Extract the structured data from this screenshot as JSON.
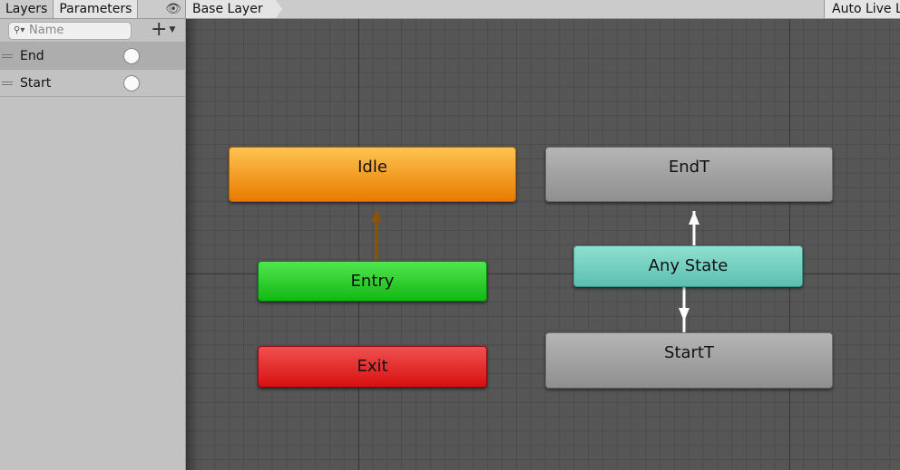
{
  "left_panel": {
    "tabs": [
      {
        "label": "Layers",
        "active": false
      },
      {
        "label": "Parameters",
        "active": true
      }
    ],
    "search_placeholder": "Name",
    "parameters": [
      {
        "name": "End",
        "type": "trigger",
        "selected": true
      },
      {
        "name": "Start",
        "type": "trigger",
        "selected": false
      }
    ]
  },
  "top_bar": {
    "breadcrumb": "Base Layer",
    "auto_live_link": "Auto Live Link"
  },
  "graph": {
    "states": {
      "idle": "Idle",
      "endt": "EndT",
      "entry": "Entry",
      "any_state": "Any State",
      "exit": "Exit",
      "startt": "StartT"
    },
    "colors": {
      "default_state": "#e87b00",
      "entry": "#14b814",
      "any_state": "#5cbfb0",
      "exit": "#d81010",
      "state": "#9f9f9f",
      "default_transition": "#8a5500"
    }
  }
}
